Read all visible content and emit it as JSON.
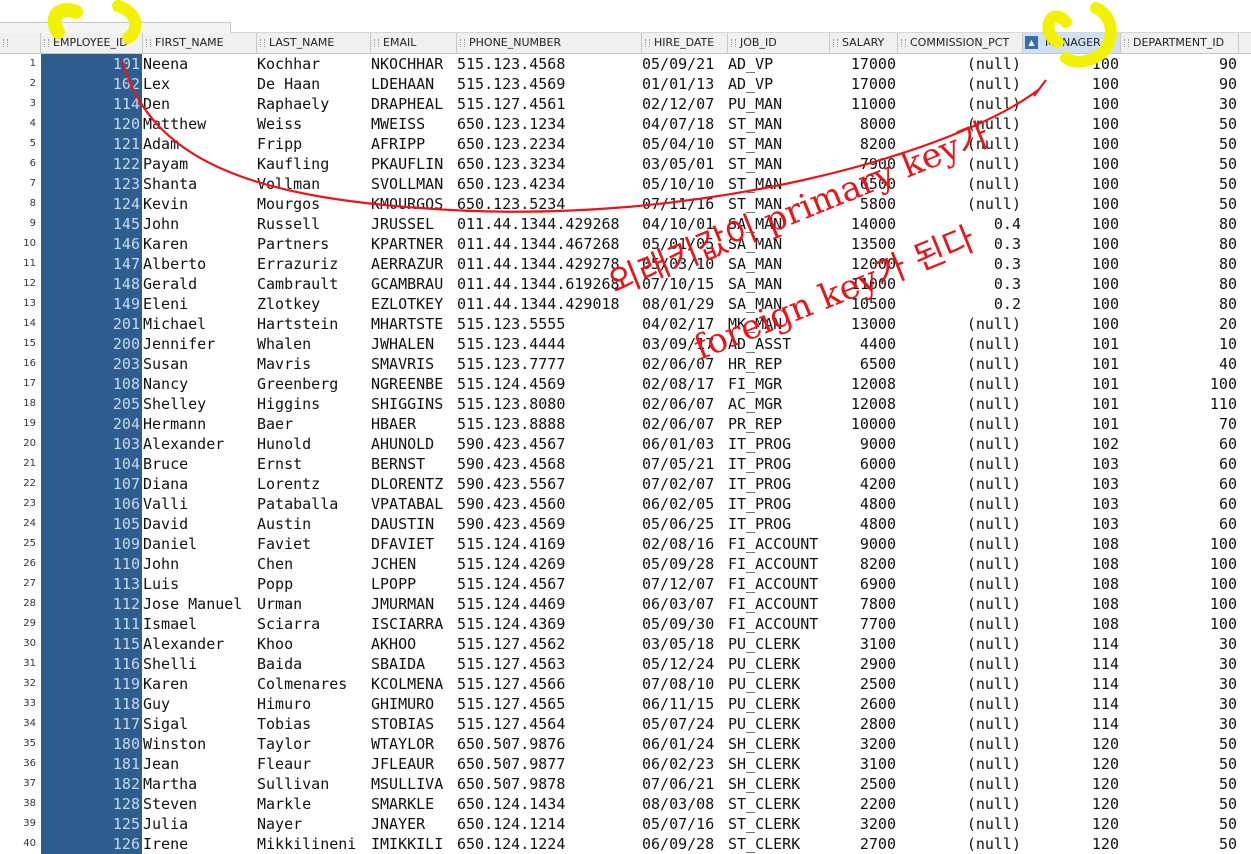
{
  "columns": [
    {
      "name": "EMPLOYEE_ID"
    },
    {
      "name": "FIRST_NAME"
    },
    {
      "name": "LAST_NAME"
    },
    {
      "name": "EMAIL"
    },
    {
      "name": "PHONE_NUMBER"
    },
    {
      "name": "HIRE_DATE"
    },
    {
      "name": "JOB_ID"
    },
    {
      "name": "SALARY"
    },
    {
      "name": "COMMISSION_PCT"
    },
    {
      "name": "MANAGER..."
    },
    {
      "name": "DEPARTMENT_ID"
    }
  ],
  "rows": [
    {
      "n": "1",
      "id": "101",
      "fn": "Neena",
      "ln": "Kochhar",
      "em": "NKOCHHAR",
      "ph": "515.123.4568",
      "hd": "05/09/21",
      "job": "AD_VP",
      "sal": "17000",
      "com": "(null)",
      "mgr": "100",
      "dept": "90"
    },
    {
      "n": "2",
      "id": "102",
      "fn": "Lex",
      "ln": "De Haan",
      "em": "LDEHAAN",
      "ph": "515.123.4569",
      "hd": "01/01/13",
      "job": "AD_VP",
      "sal": "17000",
      "com": "(null)",
      "mgr": "100",
      "dept": "90"
    },
    {
      "n": "3",
      "id": "114",
      "fn": "Den",
      "ln": "Raphaely",
      "em": "DRAPHEAL",
      "ph": "515.127.4561",
      "hd": "02/12/07",
      "job": "PU_MAN",
      "sal": "11000",
      "com": "(null)",
      "mgr": "100",
      "dept": "30"
    },
    {
      "n": "4",
      "id": "120",
      "fn": "Matthew",
      "ln": "Weiss",
      "em": "MWEISS",
      "ph": "650.123.1234",
      "hd": "04/07/18",
      "job": "ST_MAN",
      "sal": "8000",
      "com": "(null)",
      "mgr": "100",
      "dept": "50"
    },
    {
      "n": "5",
      "id": "121",
      "fn": "Adam",
      "ln": "Fripp",
      "em": "AFRIPP",
      "ph": "650.123.2234",
      "hd": "05/04/10",
      "job": "ST_MAN",
      "sal": "8200",
      "com": "(null)",
      "mgr": "100",
      "dept": "50"
    },
    {
      "n": "6",
      "id": "122",
      "fn": "Payam",
      "ln": "Kaufling",
      "em": "PKAUFLIN",
      "ph": "650.123.3234",
      "hd": "03/05/01",
      "job": "ST_MAN",
      "sal": "7900",
      "com": "(null)",
      "mgr": "100",
      "dept": "50"
    },
    {
      "n": "7",
      "id": "123",
      "fn": "Shanta",
      "ln": "Vollman",
      "em": "SVOLLMAN",
      "ph": "650.123.4234",
      "hd": "05/10/10",
      "job": "ST_MAN",
      "sal": "6500",
      "com": "(null)",
      "mgr": "100",
      "dept": "50"
    },
    {
      "n": "8",
      "id": "124",
      "fn": "Kevin",
      "ln": "Mourgos",
      "em": "KMOURGOS",
      "ph": "650.123.5234",
      "hd": "07/11/16",
      "job": "ST_MAN",
      "sal": "5800",
      "com": "(null)",
      "mgr": "100",
      "dept": "50"
    },
    {
      "n": "9",
      "id": "145",
      "fn": "John",
      "ln": "Russell",
      "em": "JRUSSEL",
      "ph": "011.44.1344.429268",
      "hd": "04/10/01",
      "job": "SA_MAN",
      "sal": "14000",
      "com": "0.4",
      "mgr": "100",
      "dept": "80"
    },
    {
      "n": "10",
      "id": "146",
      "fn": "Karen",
      "ln": "Partners",
      "em": "KPARTNER",
      "ph": "011.44.1344.467268",
      "hd": "05/01/05",
      "job": "SA_MAN",
      "sal": "13500",
      "com": "0.3",
      "mgr": "100",
      "dept": "80"
    },
    {
      "n": "11",
      "id": "147",
      "fn": "Alberto",
      "ln": "Errazuriz",
      "em": "AERRAZUR",
      "ph": "011.44.1344.429278",
      "hd": "05/03/10",
      "job": "SA_MAN",
      "sal": "12000",
      "com": "0.3",
      "mgr": "100",
      "dept": "80"
    },
    {
      "n": "12",
      "id": "148",
      "fn": "Gerald",
      "ln": "Cambrault",
      "em": "GCAMBRAU",
      "ph": "011.44.1344.619268",
      "hd": "07/10/15",
      "job": "SA_MAN",
      "sal": "11000",
      "com": "0.3",
      "mgr": "100",
      "dept": "80"
    },
    {
      "n": "13",
      "id": "149",
      "fn": "Eleni",
      "ln": "Zlotkey",
      "em": "EZLOTKEY",
      "ph": "011.44.1344.429018",
      "hd": "08/01/29",
      "job": "SA_MAN",
      "sal": "10500",
      "com": "0.2",
      "mgr": "100",
      "dept": "80"
    },
    {
      "n": "14",
      "id": "201",
      "fn": "Michael",
      "ln": "Hartstein",
      "em": "MHARTSTE",
      "ph": "515.123.5555",
      "hd": "04/02/17",
      "job": "MK_MAN",
      "sal": "13000",
      "com": "(null)",
      "mgr": "100",
      "dept": "20"
    },
    {
      "n": "15",
      "id": "200",
      "fn": "Jennifer",
      "ln": "Whalen",
      "em": "JWHALEN",
      "ph": "515.123.4444",
      "hd": "03/09/17",
      "job": "AD_ASST",
      "sal": "4400",
      "com": "(null)",
      "mgr": "101",
      "dept": "10"
    },
    {
      "n": "16",
      "id": "203",
      "fn": "Susan",
      "ln": "Mavris",
      "em": "SMAVRIS",
      "ph": "515.123.7777",
      "hd": "02/06/07",
      "job": "HR_REP",
      "sal": "6500",
      "com": "(null)",
      "mgr": "101",
      "dept": "40"
    },
    {
      "n": "17",
      "id": "108",
      "fn": "Nancy",
      "ln": "Greenberg",
      "em": "NGREENBE",
      "ph": "515.124.4569",
      "hd": "02/08/17",
      "job": "FI_MGR",
      "sal": "12008",
      "com": "(null)",
      "mgr": "101",
      "dept": "100"
    },
    {
      "n": "18",
      "id": "205",
      "fn": "Shelley",
      "ln": "Higgins",
      "em": "SHIGGINS",
      "ph": "515.123.8080",
      "hd": "02/06/07",
      "job": "AC_MGR",
      "sal": "12008",
      "com": "(null)",
      "mgr": "101",
      "dept": "110"
    },
    {
      "n": "19",
      "id": "204",
      "fn": "Hermann",
      "ln": "Baer",
      "em": "HBAER",
      "ph": "515.123.8888",
      "hd": "02/06/07",
      "job": "PR_REP",
      "sal": "10000",
      "com": "(null)",
      "mgr": "101",
      "dept": "70"
    },
    {
      "n": "20",
      "id": "103",
      "fn": "Alexander",
      "ln": "Hunold",
      "em": "AHUNOLD",
      "ph": "590.423.4567",
      "hd": "06/01/03",
      "job": "IT_PROG",
      "sal": "9000",
      "com": "(null)",
      "mgr": "102",
      "dept": "60"
    },
    {
      "n": "21",
      "id": "104",
      "fn": "Bruce",
      "ln": "Ernst",
      "em": "BERNST",
      "ph": "590.423.4568",
      "hd": "07/05/21",
      "job": "IT_PROG",
      "sal": "6000",
      "com": "(null)",
      "mgr": "103",
      "dept": "60"
    },
    {
      "n": "22",
      "id": "107",
      "fn": "Diana",
      "ln": "Lorentz",
      "em": "DLORENTZ",
      "ph": "590.423.5567",
      "hd": "07/02/07",
      "job": "IT_PROG",
      "sal": "4200",
      "com": "(null)",
      "mgr": "103",
      "dept": "60"
    },
    {
      "n": "23",
      "id": "106",
      "fn": "Valli",
      "ln": "Pataballa",
      "em": "VPATABAL",
      "ph": "590.423.4560",
      "hd": "06/02/05",
      "job": "IT_PROG",
      "sal": "4800",
      "com": "(null)",
      "mgr": "103",
      "dept": "60"
    },
    {
      "n": "24",
      "id": "105",
      "fn": "David",
      "ln": "Austin",
      "em": "DAUSTIN",
      "ph": "590.423.4569",
      "hd": "05/06/25",
      "job": "IT_PROG",
      "sal": "4800",
      "com": "(null)",
      "mgr": "103",
      "dept": "60"
    },
    {
      "n": "25",
      "id": "109",
      "fn": "Daniel",
      "ln": "Faviet",
      "em": "DFAVIET",
      "ph": "515.124.4169",
      "hd": "02/08/16",
      "job": "FI_ACCOUNT",
      "sal": "9000",
      "com": "(null)",
      "mgr": "108",
      "dept": "100"
    },
    {
      "n": "26",
      "id": "110",
      "fn": "John",
      "ln": "Chen",
      "em": "JCHEN",
      "ph": "515.124.4269",
      "hd": "05/09/28",
      "job": "FI_ACCOUNT",
      "sal": "8200",
      "com": "(null)",
      "mgr": "108",
      "dept": "100"
    },
    {
      "n": "27",
      "id": "113",
      "fn": "Luis",
      "ln": "Popp",
      "em": "LPOPP",
      "ph": "515.124.4567",
      "hd": "07/12/07",
      "job": "FI_ACCOUNT",
      "sal": "6900",
      "com": "(null)",
      "mgr": "108",
      "dept": "100"
    },
    {
      "n": "28",
      "id": "112",
      "fn": "Jose Manuel",
      "ln": "Urman",
      "em": "JMURMAN",
      "ph": "515.124.4469",
      "hd": "06/03/07",
      "job": "FI_ACCOUNT",
      "sal": "7800",
      "com": "(null)",
      "mgr": "108",
      "dept": "100"
    },
    {
      "n": "29",
      "id": "111",
      "fn": "Ismael",
      "ln": "Sciarra",
      "em": "ISCIARRA",
      "ph": "515.124.4369",
      "hd": "05/09/30",
      "job": "FI_ACCOUNT",
      "sal": "7700",
      "com": "(null)",
      "mgr": "108",
      "dept": "100"
    },
    {
      "n": "30",
      "id": "115",
      "fn": "Alexander",
      "ln": "Khoo",
      "em": "AKHOO",
      "ph": "515.127.4562",
      "hd": "03/05/18",
      "job": "PU_CLERK",
      "sal": "3100",
      "com": "(null)",
      "mgr": "114",
      "dept": "30"
    },
    {
      "n": "31",
      "id": "116",
      "fn": "Shelli",
      "ln": "Baida",
      "em": "SBAIDA",
      "ph": "515.127.4563",
      "hd": "05/12/24",
      "job": "PU_CLERK",
      "sal": "2900",
      "com": "(null)",
      "mgr": "114",
      "dept": "30"
    },
    {
      "n": "32",
      "id": "119",
      "fn": "Karen",
      "ln": "Colmenares",
      "em": "KCOLMENA",
      "ph": "515.127.4566",
      "hd": "07/08/10",
      "job": "PU_CLERK",
      "sal": "2500",
      "com": "(null)",
      "mgr": "114",
      "dept": "30"
    },
    {
      "n": "33",
      "id": "118",
      "fn": "Guy",
      "ln": "Himuro",
      "em": "GHIMURO",
      "ph": "515.127.4565",
      "hd": "06/11/15",
      "job": "PU_CLERK",
      "sal": "2600",
      "com": "(null)",
      "mgr": "114",
      "dept": "30"
    },
    {
      "n": "34",
      "id": "117",
      "fn": "Sigal",
      "ln": "Tobias",
      "em": "STOBIAS",
      "ph": "515.127.4564",
      "hd": "05/07/24",
      "job": "PU_CLERK",
      "sal": "2800",
      "com": "(null)",
      "mgr": "114",
      "dept": "30"
    },
    {
      "n": "35",
      "id": "180",
      "fn": "Winston",
      "ln": "Taylor",
      "em": "WTAYLOR",
      "ph": "650.507.9876",
      "hd": "06/01/24",
      "job": "SH_CLERK",
      "sal": "3200",
      "com": "(null)",
      "mgr": "120",
      "dept": "50"
    },
    {
      "n": "36",
      "id": "181",
      "fn": "Jean",
      "ln": "Fleaur",
      "em": "JFLEAUR",
      "ph": "650.507.9877",
      "hd": "06/02/23",
      "job": "SH_CLERK",
      "sal": "3100",
      "com": "(null)",
      "mgr": "120",
      "dept": "50"
    },
    {
      "n": "37",
      "id": "182",
      "fn": "Martha",
      "ln": "Sullivan",
      "em": "MSULLIVA",
      "ph": "650.507.9878",
      "hd": "07/06/21",
      "job": "SH_CLERK",
      "sal": "2500",
      "com": "(null)",
      "mgr": "120",
      "dept": "50"
    },
    {
      "n": "38",
      "id": "128",
      "fn": "Steven",
      "ln": "Markle",
      "em": "SMARKLE",
      "ph": "650.124.1434",
      "hd": "08/03/08",
      "job": "ST_CLERK",
      "sal": "2200",
      "com": "(null)",
      "mgr": "120",
      "dept": "50"
    },
    {
      "n": "39",
      "id": "125",
      "fn": "Julia",
      "ln": "Nayer",
      "em": "JNAYER",
      "ph": "650.124.1214",
      "hd": "05/07/16",
      "job": "ST_CLERK",
      "sal": "3200",
      "com": "(null)",
      "mgr": "120",
      "dept": "50"
    },
    {
      "n": "40",
      "id": "126",
      "fn": "Irene",
      "ln": "Mikkilineni",
      "em": "IMIKKILI",
      "ph": "650.124.1224",
      "hd": "06/09/28",
      "job": "ST_CLERK",
      "sal": "2700",
      "com": "(null)",
      "mgr": "120",
      "dept": "50"
    }
  ],
  "annotation": {
    "line1": "외래키값이 primary key가",
    "line2": "foreign key가 된다",
    "ink_color": "#e8151b",
    "marker_color": "#f2f200"
  }
}
